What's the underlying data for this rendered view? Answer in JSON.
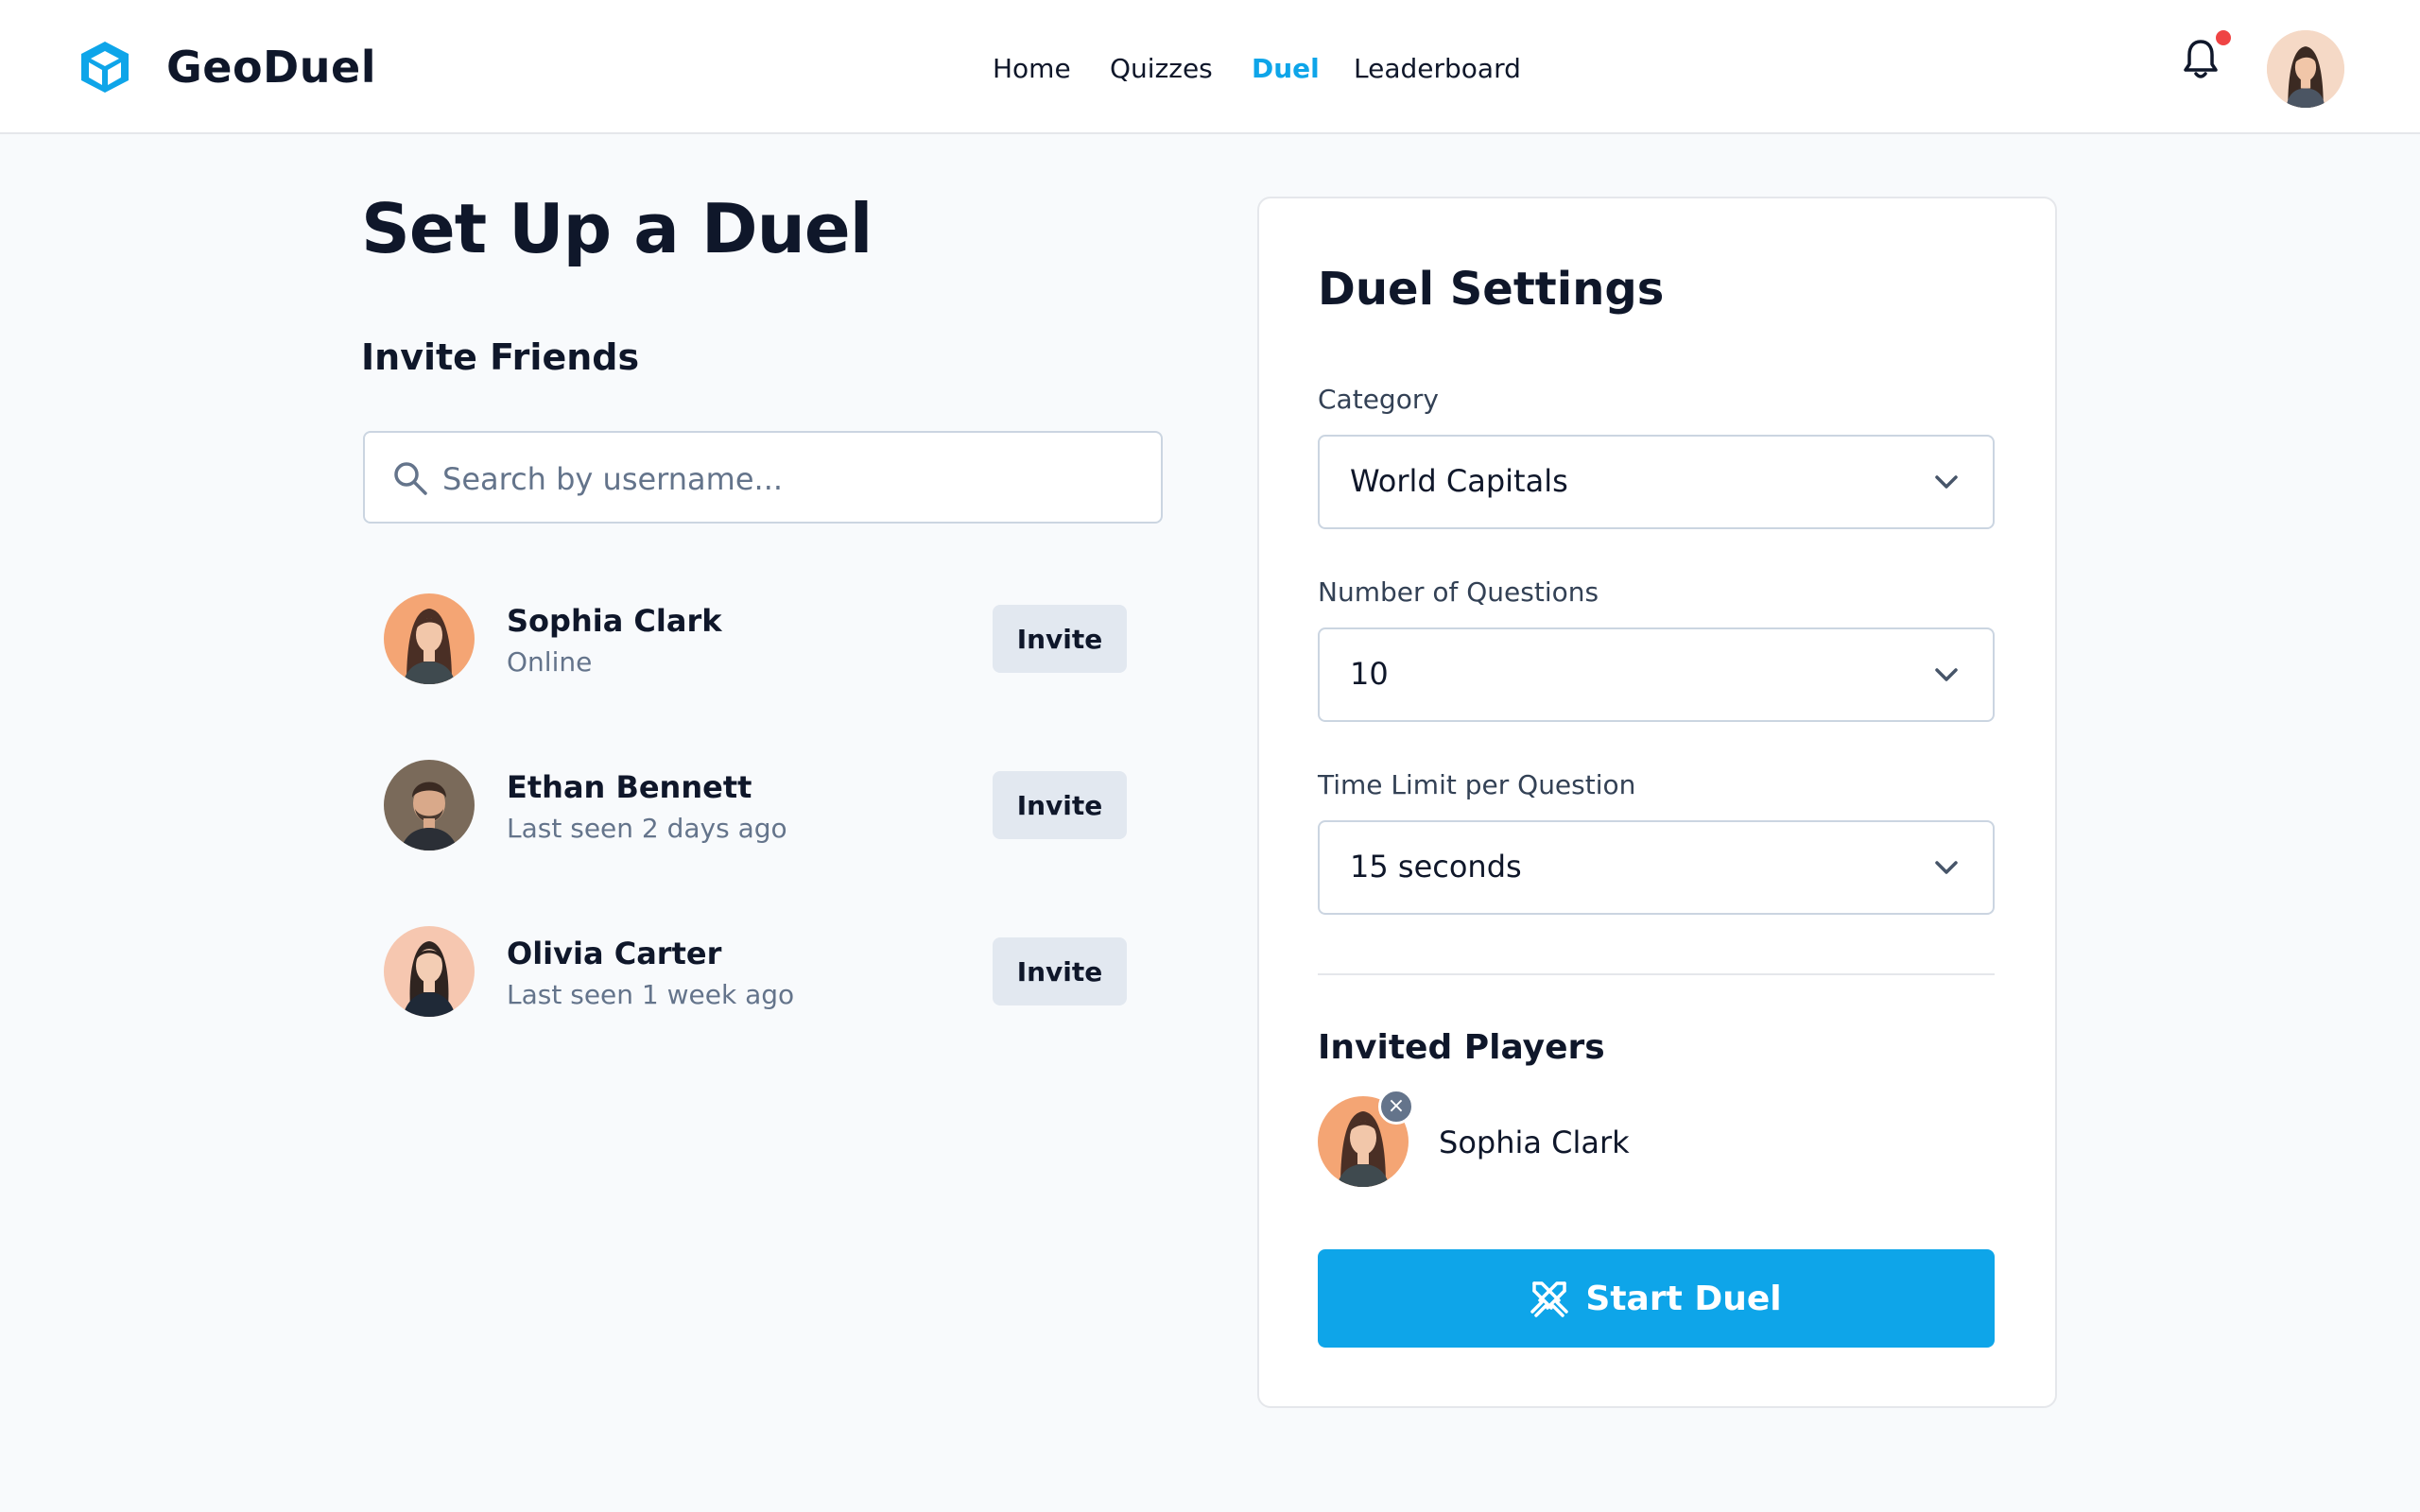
{
  "app": {
    "brand": "GeoDuel",
    "brand_color": "#0ea5e9"
  },
  "nav": [
    {
      "label": "Home",
      "active": false
    },
    {
      "label": "Quizzes",
      "active": false
    },
    {
      "label": "Duel",
      "active": true
    },
    {
      "label": "Leaderboard",
      "active": false
    }
  ],
  "header": {
    "notification_icon": "bell-icon",
    "has_unread": true,
    "avatar_icon": "user-avatar"
  },
  "page": {
    "title": "Set Up a Duel"
  },
  "invite": {
    "title": "Invite Friends",
    "search": {
      "placeholder": "Search by username...",
      "value": ""
    },
    "friends": [
      {
        "name": "Sophia Clark",
        "status": "Online",
        "action": "Invite"
      },
      {
        "name": "Ethan Bennett",
        "status": "Last seen 2 days ago",
        "action": "Invite"
      },
      {
        "name": "Olivia Carter",
        "status": "Last seen 1 week ago",
        "action": "Invite"
      }
    ]
  },
  "settings": {
    "title": "Duel Settings",
    "category": {
      "label": "Category",
      "value": "World Capitals"
    },
    "questions": {
      "label": "Number of Questions",
      "value": "10"
    },
    "time_limit": {
      "label": "Time Limit per Question",
      "value": "15 seconds"
    },
    "invited": {
      "title": "Invited Players",
      "players": [
        {
          "name": "Sophia Clark"
        }
      ]
    },
    "start_label": "Start Duel"
  }
}
